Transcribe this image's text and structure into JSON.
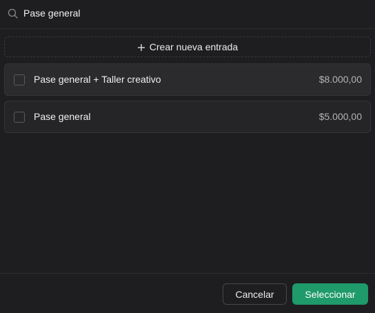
{
  "search": {
    "value": "Pase general",
    "icon": "search-icon"
  },
  "create_entry": {
    "label": "Crear nueva entrada",
    "icon": "plus-icon"
  },
  "items": [
    {
      "label": "Pase general + Taller creativo",
      "price": "$8.000,00",
      "checked": false
    },
    {
      "label": "Pase general",
      "price": "$5.000,00",
      "checked": false
    }
  ],
  "footer": {
    "cancel_label": "Cancelar",
    "select_label": "Seleccionar"
  },
  "colors": {
    "background": "#1e1e20",
    "accent": "#1f9a6a"
  }
}
